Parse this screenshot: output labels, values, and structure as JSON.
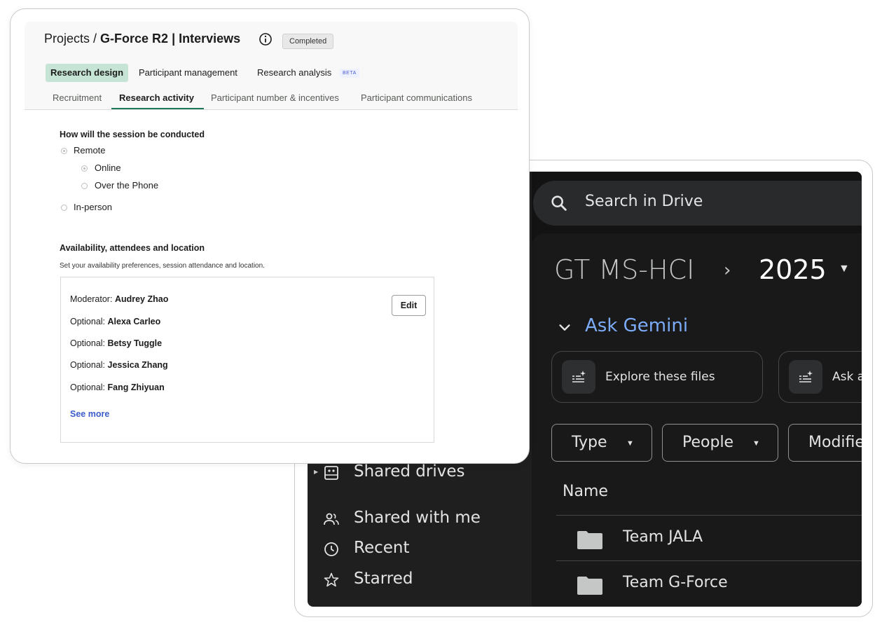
{
  "drive": {
    "search_placeholder": "Search in Drive",
    "breadcrumb": {
      "root": "GT MS-HCI",
      "separator": "›",
      "current": "2025"
    },
    "gemini": {
      "label": "Ask Gemini"
    },
    "suggestions": [
      {
        "label": "Explore these files"
      },
      {
        "label": "Ask a"
      }
    ],
    "filters": [
      {
        "label": "Type"
      },
      {
        "label": "People"
      },
      {
        "label": "Modifie"
      }
    ],
    "nav": [
      {
        "label": "Shared drives",
        "icon": "shared-drives-icon"
      },
      {
        "label": "Shared with me",
        "icon": "shared-with-me-icon"
      },
      {
        "label": "Recent",
        "icon": "clock-icon"
      },
      {
        "label": "Starred",
        "icon": "star-icon"
      }
    ],
    "list": {
      "column_name": "Name",
      "files": [
        {
          "name": "Team JALA",
          "icon": "folder-icon"
        },
        {
          "name": "Team G-Force",
          "icon": "folder-icon"
        }
      ]
    },
    "colors": {
      "background": "#1f1f1f",
      "accent": "#7cacf8"
    }
  },
  "research": {
    "breadcrumb": {
      "projects": "Projects /",
      "project": "G-Force R2 | Interviews"
    },
    "status": "Completed",
    "tabs": [
      {
        "label": "Research design",
        "active": true
      },
      {
        "label": "Participant management",
        "active": false
      },
      {
        "label": "Research analysis",
        "active": false,
        "badge": "BETA"
      }
    ],
    "subtabs": [
      {
        "label": "Recruitment",
        "active": false
      },
      {
        "label": "Research activity",
        "active": true
      },
      {
        "label": "Participant number & incentives",
        "active": false
      },
      {
        "label": "Participant communications",
        "active": false
      }
    ],
    "session": {
      "question": "How will the session be conducted",
      "options": {
        "remote": "Remote",
        "online": "Online",
        "phone": "Over the Phone",
        "in_person": "In-person"
      },
      "selected": [
        "Remote",
        "Online"
      ]
    },
    "availability": {
      "title": "Availability, attendees and location",
      "description": "Set your availability preferences, session attendance and location.",
      "attendees": [
        {
          "role": "Moderator:",
          "name": "Audrey Zhao"
        },
        {
          "role": "Optional:",
          "name": "Alexa Carleo"
        },
        {
          "role": "Optional:",
          "name": "Betsy Tuggle"
        },
        {
          "role": "Optional:",
          "name": "Jessica Zhang"
        },
        {
          "role": "Optional:",
          "name": "Fang Zhiyuan"
        }
      ],
      "edit_label": "Edit",
      "see_more": "See more"
    },
    "colors": {
      "active_tab": "#c6e4d6",
      "link": "#3b5cc9",
      "underline": "#1e7a5a"
    }
  }
}
